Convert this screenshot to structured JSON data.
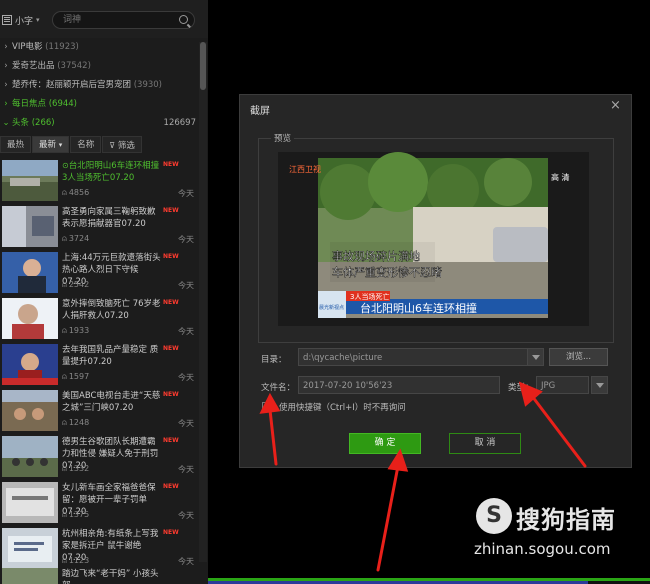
{
  "sidebar": {
    "menu_label": "小字",
    "search": {
      "placeholder": "词神"
    },
    "categories": [
      {
        "arrow": "›",
        "label": "VIP电影",
        "count": "(11923)"
      },
      {
        "arrow": "›",
        "label": "爱奇艺出品",
        "count": "(37542)"
      },
      {
        "arrow": "›",
        "label": "楚乔传：赵丽颖开启后宫男宠团",
        "count": "(3930)"
      },
      {
        "arrow": "›",
        "label": "每日焦点",
        "count": "(6944)"
      },
      {
        "arrow": "⌄",
        "label": "头条",
        "count": "(266)",
        "right": "126697"
      }
    ],
    "tabs": [
      "最热",
      "最新",
      "名称",
      "筛选"
    ],
    "items": [
      {
        "title": "台北阳明山6车连环相撞 3人当场死亡07.20",
        "badge": "NEW",
        "views": "4856",
        "time": "今天"
      },
      {
        "title": "高圣勇向家属三鞠躬致歉 表示愿捐献器官07.20",
        "badge": "NEW",
        "views": "3724",
        "time": "今天"
      },
      {
        "title": "上海:44万元巨款遗落街头 热心路人烈日下守候07.20",
        "badge": "NEW",
        "views": "2542",
        "time": "今天"
      },
      {
        "title": "意外摔倒致脑死亡 76岁老人捐肝救人07.20",
        "badge": "NEW",
        "views": "1933",
        "time": "今天"
      },
      {
        "title": "去年我国乳品产量稳定 质量提升07.20",
        "badge": "NEW",
        "views": "1597",
        "time": "今天"
      },
      {
        "title": "美国ABC电视台走进“天慈之城”三门峡07.20",
        "badge": "NEW",
        "views": "1248",
        "time": "今天"
      },
      {
        "title": "德男生谷歌团队长期遭霸力和性侵 嫌疑人免于刑罚07.20",
        "badge": "NEW",
        "views": "1332",
        "time": "今天"
      },
      {
        "title": "女儿新车画全家福爸爸保留：愿被开一辈子罚单07.20",
        "badge": "NEW",
        "views": "1375",
        "time": "今天"
      },
      {
        "title": "杭州相亲角:有纸条上写我家是拆迁户 鼠牛谢绝07.20",
        "badge": "NEW",
        "views": "1123",
        "time": "今天"
      },
      {
        "title": "踏边飞来“老干妈” 小孩头部",
        "badge": "",
        "views": "",
        "time": ""
      }
    ]
  },
  "dialog": {
    "title": "截屏",
    "close": "×",
    "preview_label": "预览",
    "preview_caption": {
      "logo": "江西卫视",
      "hd": "高 清",
      "line1": "事故现场碎片满地",
      "line2": "车体严重变形惨不忍睹",
      "tag": "3人当场死亡",
      "headline": "台北阳明山6车连环相撞",
      "news_logo": "晨光新视点"
    },
    "dir_label": "目录：",
    "dir_value": "d:\\qycache\\picture",
    "browse_label": "浏览...",
    "filename_label": "文件名：",
    "filename_value": "2017-07-20 10'56'23",
    "type_label": "类型：",
    "type_value": "JPG",
    "shortcut_label": "使用快捷键（Ctrl+I）时不再询问",
    "ok_label": "确 定",
    "cancel_label": "取 消"
  },
  "watermark": {
    "logo": "S",
    "brand": "搜狗指南",
    "url": "zhinan.sogou.com"
  },
  "colors": {
    "accent_green": "#2e9a12",
    "highlight_green": "#4fbf2f",
    "new_badge": "#ff3b2f",
    "arrow_red": "#e8201a"
  }
}
